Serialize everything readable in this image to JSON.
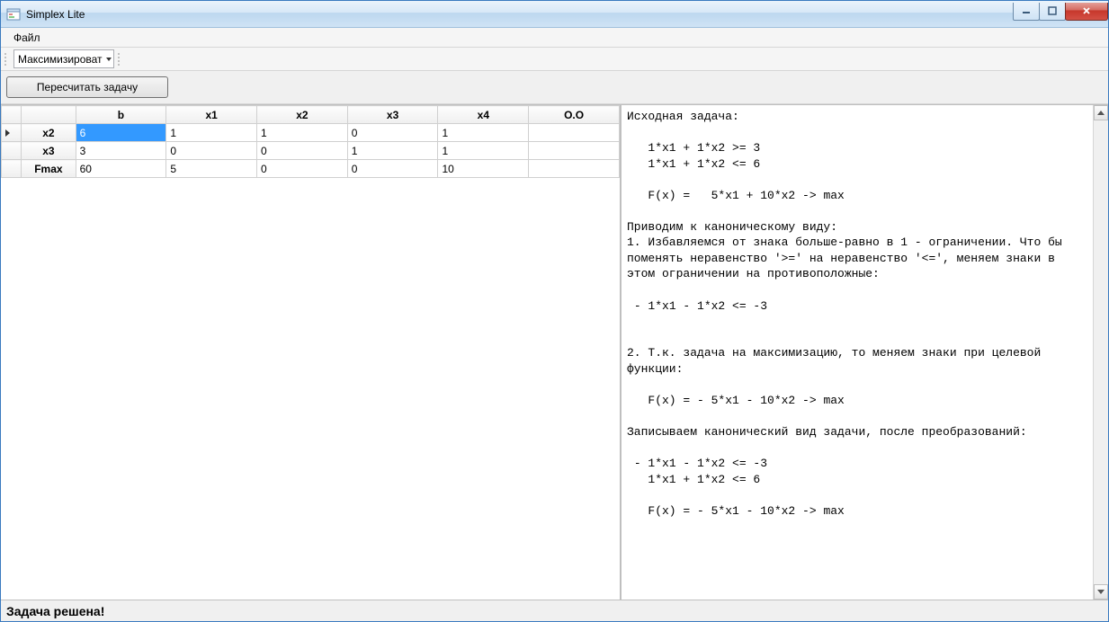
{
  "window": {
    "title": "Simplex Lite"
  },
  "menu": {
    "file": "Файл"
  },
  "toolbar": {
    "combo_value": "Максимизироват"
  },
  "buttonbar": {
    "recalc": "Пересчитать задачу"
  },
  "grid": {
    "columns": [
      "b",
      "x1",
      "x2",
      "x3",
      "x4",
      "О.О"
    ],
    "rows": [
      {
        "label": "x2",
        "cells": [
          "6",
          "1",
          "1",
          "0",
          "1",
          ""
        ],
        "active": true,
        "selected_col": 0
      },
      {
        "label": "x3",
        "cells": [
          "3",
          "0",
          "0",
          "1",
          "1",
          ""
        ]
      },
      {
        "label": "Fmax",
        "cells": [
          "60",
          "5",
          "0",
          "0",
          "10",
          ""
        ]
      }
    ]
  },
  "solution": "Исходная задача:\n\n   1*x1 + 1*x2 >= 3\n   1*x1 + 1*x2 <= 6\n\n   F(x) =   5*x1 + 10*x2 -> max\n\nПриводим к каноническому виду:\n1. Избавляемся от знака больше-равно в 1 - ограничении. Что бы поменять неравенство '>=' на неравенство '<=', меняем знаки в этом ограничении на противоположные:\n\n - 1*x1 - 1*x2 <= -3\n\n\n2. Т.к. задача на максимизацию, то меняем знаки при целевой функции:\n\n   F(x) = - 5*x1 - 10*x2 -> max\n\nЗаписываем канонический вид задачи, после преобразований:\n\n - 1*x1 - 1*x2 <= -3\n   1*x1 + 1*x2 <= 6\n\n   F(x) = - 5*x1 - 10*x2 -> max\n",
  "status": "Задача решена!"
}
